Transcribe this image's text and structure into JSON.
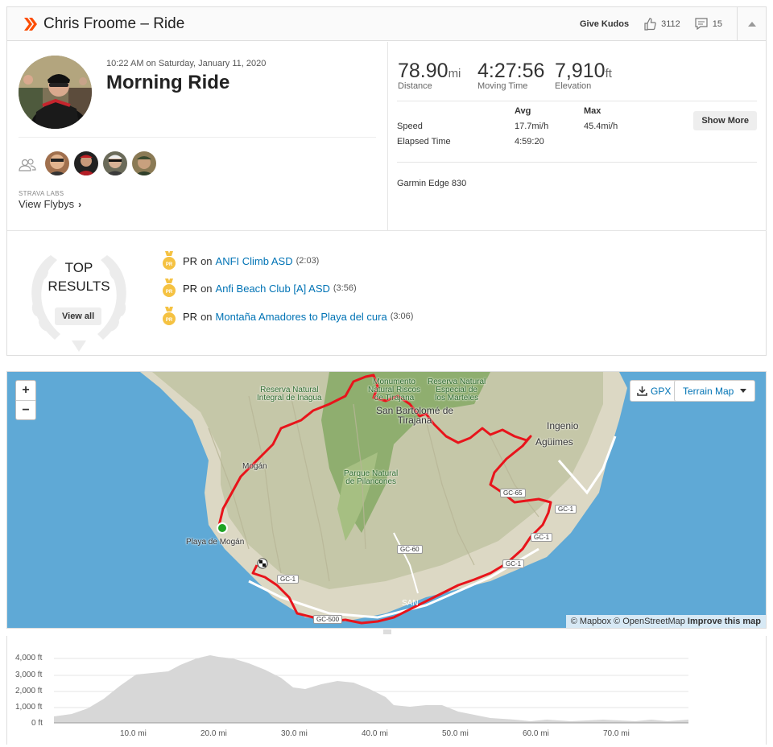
{
  "header": {
    "athlete_name": "Chris Froome – Ride",
    "give_kudos": "Give Kudos",
    "kudos_count": "3112",
    "comment_count": "15"
  },
  "activity": {
    "datetime": "10:22 AM on Saturday, January 11, 2020",
    "name": "Morning Ride",
    "labs_label": "STRAVA LABS",
    "flybys_label": "View Flybys"
  },
  "stats": {
    "distance": {
      "value": "78.90",
      "unit": "mi",
      "label": "Distance"
    },
    "moving_time": {
      "value": "4:27:56",
      "label": "Moving Time"
    },
    "elevation": {
      "value": "7,910",
      "unit": "ft",
      "label": "Elevation"
    }
  },
  "more_stats": {
    "col_avg": "Avg",
    "col_max": "Max",
    "rows": [
      {
        "label": "Speed",
        "avg": "17.7mi/h",
        "max": "45.4mi/h"
      },
      {
        "label": "Elapsed Time",
        "avg": "4:59:20",
        "max": ""
      }
    ],
    "show_more": "Show More"
  },
  "device": "Garmin Edge 830",
  "top_results": {
    "title_line1": "TOP",
    "title_line2": "RESULTS",
    "view_all": "View all",
    "items": [
      {
        "badge": "PR",
        "prefix": "PR",
        "on": "on",
        "segment": "ANFI Climb ASD",
        "time": "(2:03)"
      },
      {
        "badge": "PR",
        "prefix": "PR",
        "on": "on",
        "segment": "Anfi Beach Club [A] ASD",
        "time": "(3:56)"
      },
      {
        "badge": "PR",
        "prefix": "PR",
        "on": "on",
        "segment": "Montaña Amadores to Playa del cura",
        "time": "(3:06)"
      }
    ]
  },
  "map": {
    "zoom_in": "+",
    "zoom_out": "−",
    "gpx_label": "GPX",
    "map_type": "Terrain Map",
    "attribution": "© Mapbox © OpenStreetMap",
    "improve": "Improve this map",
    "labels": {
      "inagua": "Reserva Natural\nIntegral de Inagua",
      "monumento": "Monumento\nNatural Riscos\nde Tirajana",
      "marteles": "Reserva Natural\nEspecial de\nlos Marteles",
      "san_bartolome": "San Bartolomé de\nTirajana",
      "pilancones": "Parque Natural\nde Pilancones",
      "mogan": "Mogán",
      "playa_mogan": "Playa de Mogán",
      "ingenio": "Ingenio",
      "aguimes": "Agüimes",
      "gc65": "GC-65",
      "gc1a": "GC-1",
      "gc1b": "GC-1",
      "gc60": "GC-60",
      "gc500": "GC-500",
      "gc1c": "GC-1",
      "gc1d": "GC-1",
      "san_bartolome_south": "SAN"
    }
  },
  "elevation_chart": {
    "y_ticks": [
      "4,000 ft",
      "3,000 ft",
      "2,000 ft",
      "1,000 ft",
      "0 ft"
    ],
    "x_ticks": [
      "10.0 mi",
      "20.0 mi",
      "30.0 mi",
      "40.0 mi",
      "50.0 mi",
      "60.0 mi",
      "70.0 mi"
    ]
  },
  "colors": {
    "strava_orange": "#fc4c02",
    "route_red": "#e8141b",
    "link_blue": "#0073b5",
    "pr_gold": "#f5c242"
  }
}
